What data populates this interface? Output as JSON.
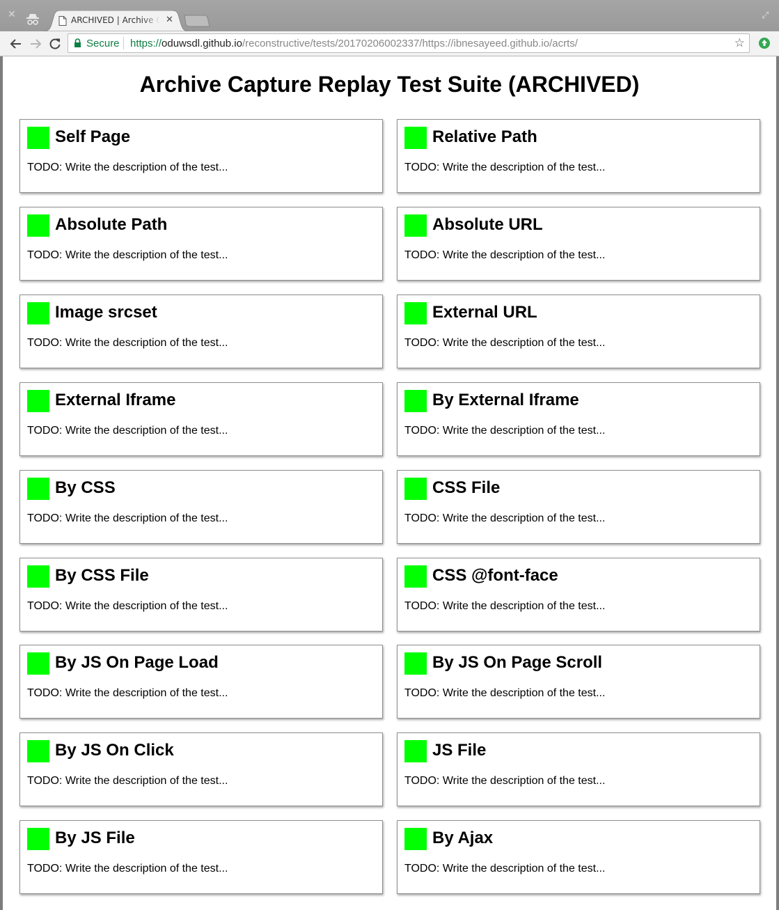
{
  "browser": {
    "tab_title": "ARCHIVED | Archive Capture Replay Test Suite",
    "secure_label": "Secure",
    "url": {
      "scheme": "https://",
      "host": "oduwsdl.github.io",
      "path": "/reconstructive/tests/20170206002337/https://ibnesayeed.github.io/acrts/"
    }
  },
  "page": {
    "title": "Archive Capture Replay Test Suite (ARCHIVED)",
    "status_color": "#00ff00",
    "tests": [
      {
        "name": "Self Page",
        "description": "TODO: Write the description of the test..."
      },
      {
        "name": "Relative Path",
        "description": "TODO: Write the description of the test..."
      },
      {
        "name": "Absolute Path",
        "description": "TODO: Write the description of the test..."
      },
      {
        "name": "Absolute URL",
        "description": "TODO: Write the description of the test..."
      },
      {
        "name": "Image srcset",
        "description": "TODO: Write the description of the test..."
      },
      {
        "name": "External URL",
        "description": "TODO: Write the description of the test..."
      },
      {
        "name": "External Iframe",
        "description": "TODO: Write the description of the test..."
      },
      {
        "name": "By External Iframe",
        "description": "TODO: Write the description of the test..."
      },
      {
        "name": "By CSS",
        "description": "TODO: Write the description of the test..."
      },
      {
        "name": "CSS File",
        "description": "TODO: Write the description of the test..."
      },
      {
        "name": "By CSS File",
        "description": "TODO: Write the description of the test..."
      },
      {
        "name": "CSS @font-face",
        "description": "TODO: Write the description of the test..."
      },
      {
        "name": "By JS On Page Load",
        "description": "TODO: Write the description of the test..."
      },
      {
        "name": "By JS On Page Scroll",
        "description": "TODO: Write the description of the test..."
      },
      {
        "name": "By JS On Click",
        "description": "TODO: Write the description of the test..."
      },
      {
        "name": "JS File",
        "description": "TODO: Write the description of the test..."
      },
      {
        "name": "By JS File",
        "description": "TODO: Write the description of the test..."
      },
      {
        "name": "By Ajax",
        "description": "TODO: Write the description of the test..."
      }
    ]
  }
}
